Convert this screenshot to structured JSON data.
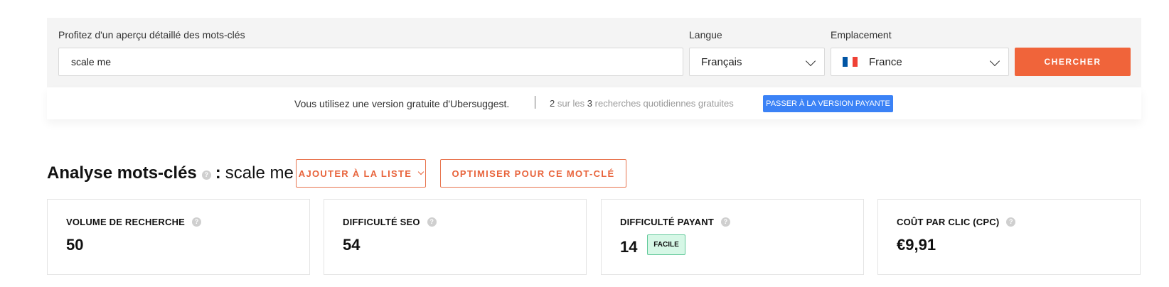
{
  "search": {
    "keyword_label": "Profitez d'un aperçu détaillé des mots-clés",
    "keyword_value": "scale me",
    "language_label": "Langue",
    "language_value": "Français",
    "location_label": "Emplacement",
    "location_value": "France",
    "location_flag_colors": [
      "#0055a4",
      "#ffffff",
      "#ef4135"
    ],
    "search_button": "CHERCHER",
    "accent_color": "#f0643a"
  },
  "notice": {
    "message": "Vous utilisez une version gratuite d'Ubersuggest.",
    "used": "2",
    "of_text": "sur les",
    "total": "3",
    "suffix": "recherches quotidiennes gratuites",
    "upgrade_button": "PASSER À LA VERSION PAYANTE"
  },
  "analysis": {
    "title": "Analyse mots-clés",
    "help_icon": "question-icon",
    "colon": ":",
    "keyword": "scale me",
    "add_to_list_button": "AJOUTER À LA LISTE",
    "optimize_button": "OPTIMISER POUR CE MOT-CLÉ"
  },
  "metrics": [
    {
      "label": "VOLUME DE RECHERCHE",
      "value": "50"
    },
    {
      "label": "DIFFICULTÉ SEO",
      "value": "54"
    },
    {
      "label": "DIFFICULTÉ PAYANT",
      "value": "14",
      "badge": "FACILE"
    },
    {
      "label": "COÛT PAR CLIC (CPC)",
      "value": "€9,91"
    }
  ]
}
